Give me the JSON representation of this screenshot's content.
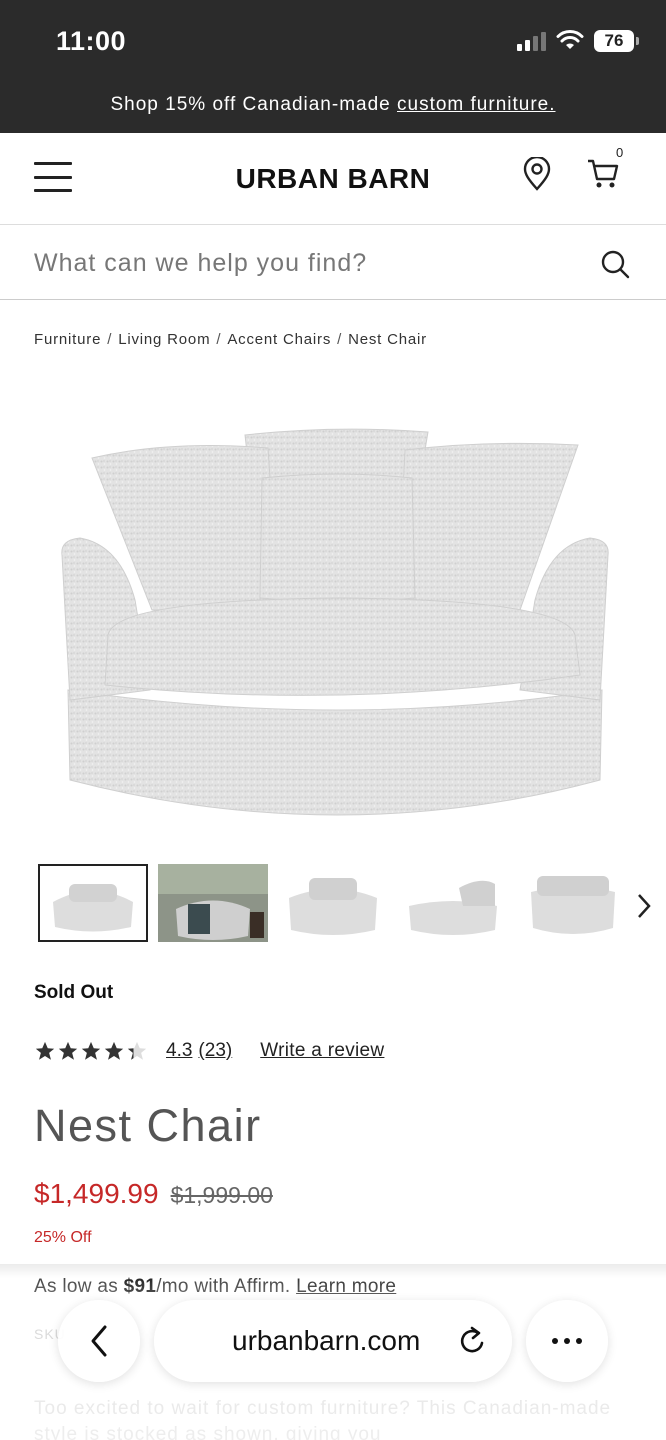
{
  "status_bar": {
    "time": "11:00",
    "battery": "76"
  },
  "promo": {
    "text": "Shop 15% off Canadian-made ",
    "link": "custom furniture."
  },
  "header": {
    "logo": "URBAN BARN",
    "cart_count": "0"
  },
  "search": {
    "placeholder": "What can we help you find?"
  },
  "breadcrumb": [
    "Furniture",
    "Living Room",
    "Accent Chairs",
    "Nest Chair"
  ],
  "product": {
    "availability": "Sold Out",
    "rating": "4.3",
    "rating_fraction": 0.86,
    "review_count": "(23)",
    "write_review": "Write a review",
    "title": "Nest Chair",
    "price": "$1,499.99",
    "original_price": "$1,999.00",
    "discount": "25% Off",
    "affirm_prefix": "As low as ",
    "affirm_amount": "$91",
    "affirm_suffix": "/mo with Affirm. ",
    "affirm_link": "Learn more",
    "sku": "SKU",
    "description": "Too excited to wait for custom furniture? This Canadian-made style is stocked as shown, giving you"
  },
  "browser": {
    "url": "urbanbarn.com"
  }
}
